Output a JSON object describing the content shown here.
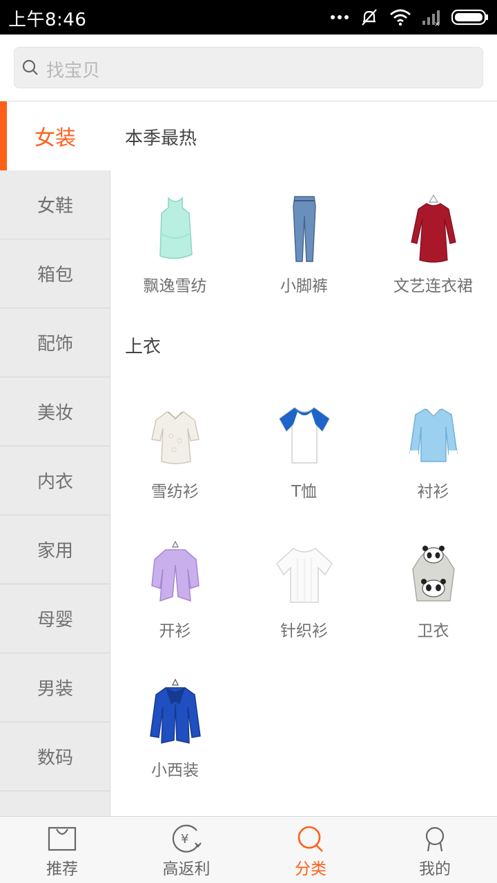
{
  "status_bar": {
    "time": "上午8:46"
  },
  "search": {
    "placeholder": "找宝贝"
  },
  "sidebar": {
    "items": [
      {
        "label": "女装",
        "active": true
      },
      {
        "label": "女鞋"
      },
      {
        "label": "箱包"
      },
      {
        "label": "配饰"
      },
      {
        "label": "美妆"
      },
      {
        "label": "内衣"
      },
      {
        "label": "家用"
      },
      {
        "label": "母婴"
      },
      {
        "label": "男装"
      },
      {
        "label": "数码"
      }
    ]
  },
  "sections": [
    {
      "title": "本季最热",
      "items": [
        {
          "label": "飘逸雪纺",
          "icon": "chiffon-top-image"
        },
        {
          "label": "小脚裤",
          "icon": "skinny-jeans-image"
        },
        {
          "label": "文艺连衣裙",
          "icon": "red-dress-image"
        }
      ]
    },
    {
      "title": "上衣",
      "items": [
        {
          "label": "雪纺衫",
          "icon": "lace-blouse-image"
        },
        {
          "label": "T恤",
          "icon": "tshirt-image"
        },
        {
          "label": "衬衫",
          "icon": "shirt-image"
        },
        {
          "label": "开衫",
          "icon": "cardigan-image"
        },
        {
          "label": "针织衫",
          "icon": "knit-top-image"
        },
        {
          "label": "卫衣",
          "icon": "hoodie-image"
        },
        {
          "label": "小西装",
          "icon": "blazer-image"
        }
      ]
    }
  ],
  "bottom_nav": {
    "items": [
      {
        "label": "推荐",
        "icon": "bag-icon"
      },
      {
        "label": "高返利",
        "icon": "rebate-icon"
      },
      {
        "label": "分类",
        "icon": "search-icon",
        "active": true
      },
      {
        "label": "我的",
        "icon": "user-icon"
      }
    ]
  },
  "colors": {
    "accent": "#ff5f19",
    "sidebar_bg": "#ebebeb",
    "text_gray": "#707070"
  }
}
